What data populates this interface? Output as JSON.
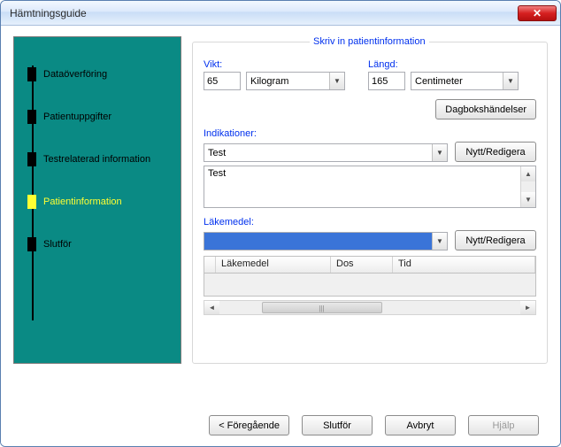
{
  "window": {
    "title": "Hämtningsguide"
  },
  "wizard": {
    "steps": [
      {
        "label": "Dataöverföring",
        "active": false
      },
      {
        "label": "Patientuppgifter",
        "active": false
      },
      {
        "label": "Testrelaterad information",
        "active": false
      },
      {
        "label": "Patientinformation",
        "active": true
      },
      {
        "label": "Slutför",
        "active": false
      }
    ]
  },
  "form": {
    "legend": "Skriv in patientinformation",
    "weight": {
      "label": "Vikt:",
      "value": "65",
      "unit": "Kilogram"
    },
    "height": {
      "label": "Längd:",
      "value": "165",
      "unit": "Centimeter"
    },
    "diary_button": "Dagbokshändelser",
    "indications": {
      "label": "Indikationer:",
      "selected": "Test",
      "edit_button": "Nytt/Redigera",
      "list_item0": "Test"
    },
    "meds": {
      "label": "Läkemedel:",
      "selected": "",
      "edit_button": "Nytt/Redigera",
      "columns": {
        "c0": "Läkemedel",
        "c1": "Dos",
        "c2": "Tid"
      }
    }
  },
  "footer": {
    "back": "< Föregående",
    "finish": "Slutför",
    "cancel": "Avbryt",
    "help": "Hjälp"
  }
}
